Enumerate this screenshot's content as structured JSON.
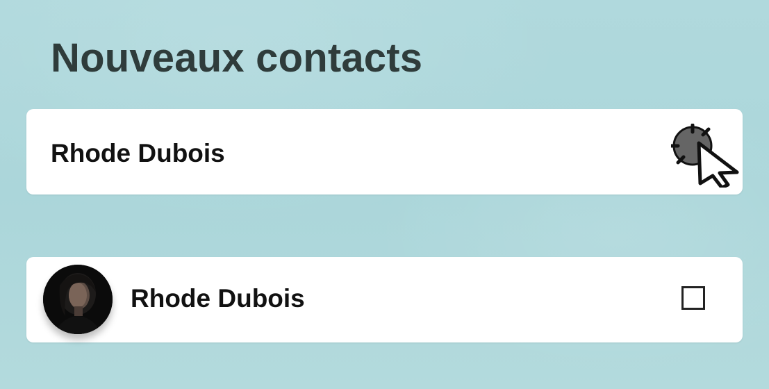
{
  "section": {
    "title": "Nouveaux contacts"
  },
  "contacts": [
    {
      "name": "Rhode Dubois",
      "action_icon": "click-pointer-icon"
    },
    {
      "name": "Rhode Dubois",
      "avatar": "contact-avatar",
      "checked": false
    }
  ],
  "colors": {
    "background": "#acd7db",
    "card": "#ffffff",
    "title": "#2f3c3b",
    "text": "#111111"
  }
}
